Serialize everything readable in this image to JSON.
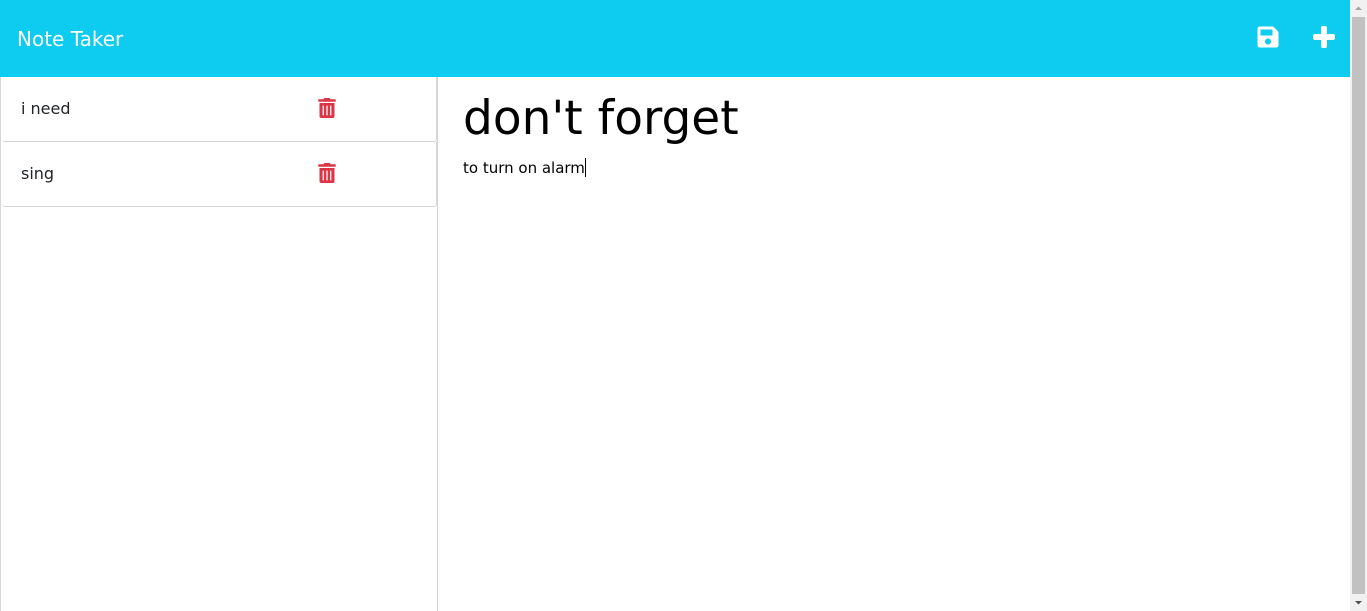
{
  "app": {
    "title": "Note Taker",
    "accent_color": "#0ecbf0"
  },
  "toolbar": {
    "save_icon": "floppy-disk-icon",
    "new_icon": "plus-icon"
  },
  "notes_list": [
    {
      "title": "i need",
      "delete_icon": "trash-icon"
    },
    {
      "title": "sing",
      "delete_icon": "trash-icon"
    }
  ],
  "editor": {
    "title": "don't forget",
    "text": "to turn on alarm"
  },
  "colors": {
    "delete": "#dc3545",
    "border": "#d6d6d6"
  }
}
